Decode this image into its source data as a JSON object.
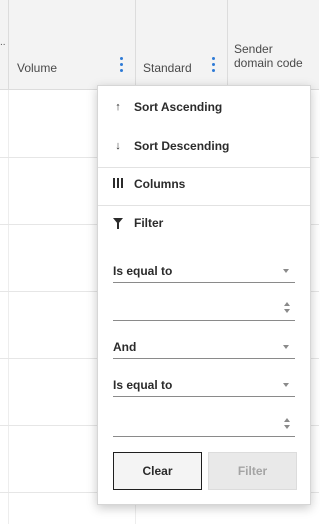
{
  "header": {
    "columns": [
      {
        "title": "Volume"
      },
      {
        "title": "Standard"
      },
      {
        "title": "Sender\ndomain code"
      }
    ],
    "left_mark": ".."
  },
  "menu": {
    "sort_ascending": {
      "label": "Sort Ascending",
      "icon": "arrow-up-icon"
    },
    "sort_descending": {
      "label": "Sort Descending",
      "icon": "arrow-down-icon"
    },
    "columns": {
      "label": "Columns",
      "icon": "columns-icon"
    },
    "filter": {
      "label": "Filter",
      "icon": "filter-icon"
    }
  },
  "filter": {
    "operator1": "Is equal to",
    "value1": "",
    "logic": "And",
    "operator2": "Is equal to",
    "value2": "",
    "clear_label": "Clear",
    "filter_label": "Filter"
  },
  "colors": {
    "accent": "#2e7ad6",
    "header_bg": "#f3f3f3",
    "disabled_text": "#a4a4a4"
  }
}
